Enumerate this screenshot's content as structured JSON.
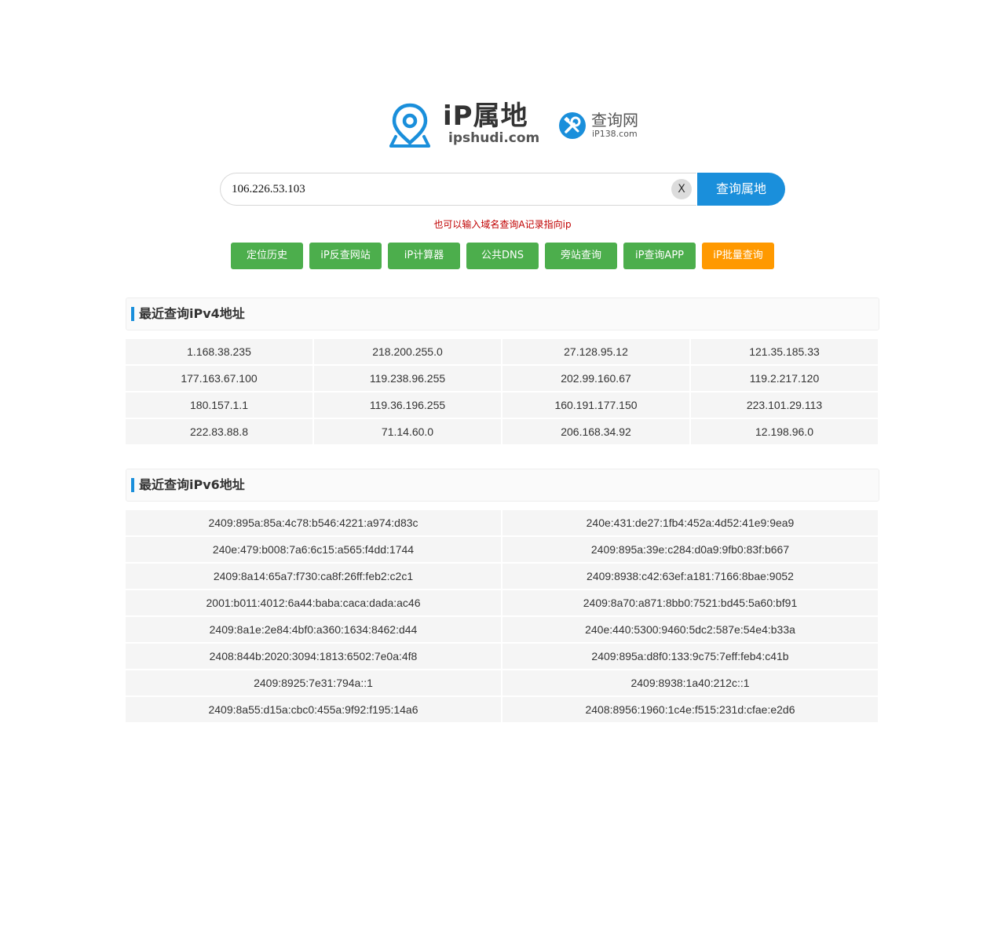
{
  "brand": {
    "title": "iP属地",
    "domain": "ipshudi.com",
    "partner_title": "查询网",
    "partner_domain": "iP138.com",
    "accent_color": "#1a8fdb"
  },
  "search": {
    "value": "106.226.53.103",
    "clear_label": "X",
    "button_label": "查询属地",
    "hint": "也可以输入域名查询A记录指向ip"
  },
  "quick_links": [
    {
      "label": "定位历史",
      "color": "#4cae4c"
    },
    {
      "label": "iP反查网站",
      "color": "#4cae4c"
    },
    {
      "label": "iP计算器",
      "color": "#4cae4c"
    },
    {
      "label": "公共DNS",
      "color": "#4cae4c"
    },
    {
      "label": "旁站查询",
      "color": "#4cae4c"
    },
    {
      "label": "iP查询APP",
      "color": "#4cae4c"
    },
    {
      "label": "iP批量查询",
      "color": "#ff9900"
    }
  ],
  "ipv4": {
    "title": "最近查询iPv4地址",
    "items": [
      "1.168.38.235",
      "218.200.255.0",
      "27.128.95.12",
      "121.35.185.33",
      "177.163.67.100",
      "119.238.96.255",
      "202.99.160.67",
      "119.2.217.120",
      "180.157.1.1",
      "119.36.196.255",
      "160.191.177.150",
      "223.101.29.113",
      "222.83.88.8",
      "71.14.60.0",
      "206.168.34.92",
      "12.198.96.0"
    ]
  },
  "ipv6": {
    "title": "最近查询iPv6地址",
    "items": [
      "2409:895a:85a:4c78:b546:4221:a974:d83c",
      "240e:431:de27:1fb4:452a:4d52:41e9:9ea9",
      "240e:479:b008:7a6:6c15:a565:f4dd:1744",
      "2409:895a:39e:c284:d0a9:9fb0:83f:b667",
      "2409:8a14:65a7:f730:ca8f:26ff:feb2:c2c1",
      "2409:8938:c42:63ef:a181:7166:8bae:9052",
      "2001:b011:4012:6a44:baba:caca:dada:ac46",
      "2409:8a70:a871:8bb0:7521:bd45:5a60:bf91",
      "2409:8a1e:2e84:4bf0:a360:1634:8462:d44",
      "240e:440:5300:9460:5dc2:587e:54e4:b33a",
      "2408:844b:2020:3094:1813:6502:7e0a:4f8",
      "2409:895a:d8f0:133:9c75:7eff:feb4:c41b",
      "2409:8925:7e31:794a::1",
      "2409:8938:1a40:212c::1",
      "2409:8a55:d15a:cbc0:455a:9f92:f195:14a6",
      "2408:8956:1960:1c4e:f515:231d:cfae:e2d6"
    ]
  }
}
